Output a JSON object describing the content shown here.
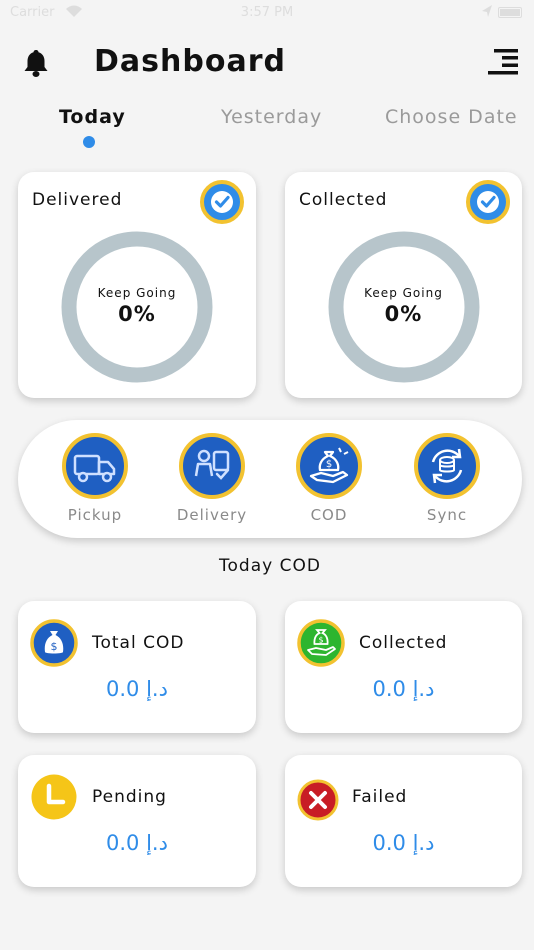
{
  "status_bar": {
    "carrier": "Carrier",
    "time": "3:57 PM"
  },
  "header": {
    "title": "Dashboard",
    "bell_icon": "bell-icon",
    "menu_icon": "menu-icon"
  },
  "tabs": [
    {
      "label": "Today",
      "active": true
    },
    {
      "label": "Yesterday",
      "active": false
    },
    {
      "label": "Choose Date",
      "active": false
    }
  ],
  "progress_cards": [
    {
      "title": "Delivered",
      "subtitle": "Keep Going",
      "value": "0%",
      "progress": 0
    },
    {
      "title": "Collected",
      "subtitle": "Keep Going",
      "value": "0%",
      "progress": 0
    }
  ],
  "actions": [
    {
      "label": "Pickup",
      "icon": "truck-icon"
    },
    {
      "label": "Delivery",
      "icon": "delivery-icon"
    },
    {
      "label": "COD",
      "icon": "money-bag-hand-icon"
    },
    {
      "label": "Sync",
      "icon": "sync-icon"
    }
  ],
  "cod_section": {
    "title": "Today COD",
    "cards": [
      {
        "label": "Total COD",
        "value": "0.0 د.إ",
        "icon": "money-bag-icon"
      },
      {
        "label": "Collected",
        "value": "0.0 د.إ",
        "icon": "money-hand-icon"
      },
      {
        "label": "Pending",
        "value": "0.0 د.إ",
        "icon": "clock-icon"
      },
      {
        "label": "Failed",
        "value": "0.0 د.إ",
        "icon": "x-icon"
      }
    ]
  },
  "colors": {
    "accent_blue": "#2f8ce8",
    "icon_blue": "#1f5fc2",
    "gold_ring": "#f2c230",
    "ring_gray": "#b7c5cb",
    "success_green": "#2db52f",
    "pending_yellow": "#f5c518",
    "failed_red": "#c81d25"
  }
}
